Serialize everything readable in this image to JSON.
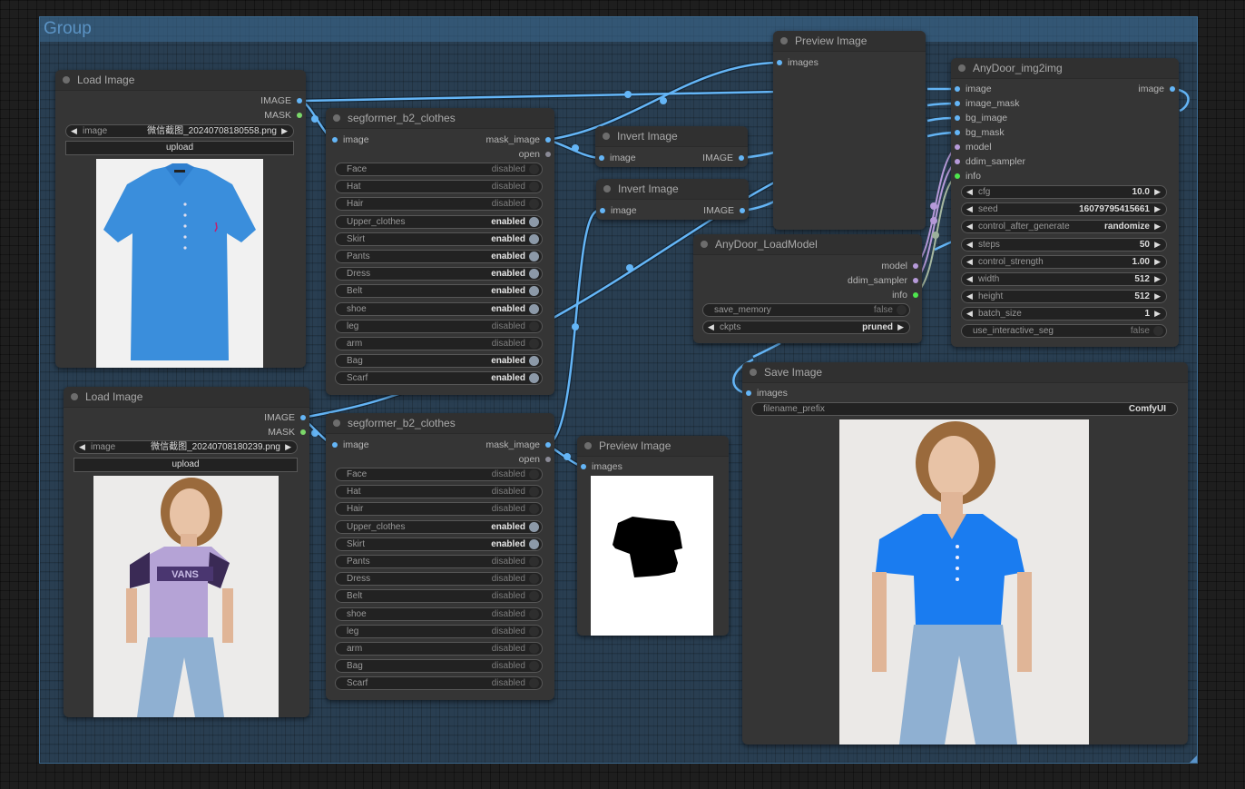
{
  "group": {
    "title": "Group"
  },
  "colors": {
    "image_link": "#64b5f6",
    "mask_slot": "#7bd86a",
    "model_slot": "#b69ad9",
    "info_slot": "#4ee64e",
    "group_bg": "#335a7c"
  },
  "load_image_1": {
    "title": "Load Image",
    "outputs": [
      "IMAGE",
      "MASK"
    ],
    "image_widget": {
      "label": "image",
      "value": "微信截图_20240708180558.png"
    },
    "upload_label": "upload",
    "preview": "blue polo shirt"
  },
  "load_image_2": {
    "title": "Load Image",
    "outputs": [
      "IMAGE",
      "MASK"
    ],
    "image_widget": {
      "label": "image",
      "value": "微信截图_20240708180239.png"
    },
    "upload_label": "upload",
    "preview": "woman in purple VANS t-shirt",
    "shirt_text": "VANS"
  },
  "segformer_1": {
    "title": "segformer_b2_clothes",
    "input": "image",
    "outputs": [
      "mask_image",
      "open"
    ],
    "toggles": [
      {
        "label": "Face",
        "value": "disabled",
        "on": false
      },
      {
        "label": "Hat",
        "value": "disabled",
        "on": false
      },
      {
        "label": "Hair",
        "value": "disabled",
        "on": false
      },
      {
        "label": "Upper_clothes",
        "value": "enabled",
        "on": true
      },
      {
        "label": "Skirt",
        "value": "enabled",
        "on": true
      },
      {
        "label": "Pants",
        "value": "enabled",
        "on": true
      },
      {
        "label": "Dress",
        "value": "enabled",
        "on": true
      },
      {
        "label": "Belt",
        "value": "enabled",
        "on": true
      },
      {
        "label": "shoe",
        "value": "enabled",
        "on": true
      },
      {
        "label": "leg",
        "value": "disabled",
        "on": false
      },
      {
        "label": "arm",
        "value": "disabled",
        "on": false
      },
      {
        "label": "Bag",
        "value": "enabled",
        "on": true
      },
      {
        "label": "Scarf",
        "value": "enabled",
        "on": true
      }
    ]
  },
  "segformer_2": {
    "title": "segformer_b2_clothes",
    "input": "image",
    "outputs": [
      "mask_image",
      "open"
    ],
    "toggles": [
      {
        "label": "Face",
        "value": "disabled",
        "on": false
      },
      {
        "label": "Hat",
        "value": "disabled",
        "on": false
      },
      {
        "label": "Hair",
        "value": "disabled",
        "on": false
      },
      {
        "label": "Upper_clothes",
        "value": "enabled",
        "on": true
      },
      {
        "label": "Skirt",
        "value": "enabled",
        "on": true
      },
      {
        "label": "Pants",
        "value": "disabled",
        "on": false
      },
      {
        "label": "Dress",
        "value": "disabled",
        "on": false
      },
      {
        "label": "Belt",
        "value": "disabled",
        "on": false
      },
      {
        "label": "shoe",
        "value": "disabled",
        "on": false
      },
      {
        "label": "leg",
        "value": "disabled",
        "on": false
      },
      {
        "label": "arm",
        "value": "disabled",
        "on": false
      },
      {
        "label": "Bag",
        "value": "disabled",
        "on": false
      },
      {
        "label": "Scarf",
        "value": "disabled",
        "on": false
      }
    ]
  },
  "invert_1": {
    "title": "Invert Image",
    "input": "image",
    "output": "IMAGE"
  },
  "invert_2": {
    "title": "Invert Image",
    "input": "image",
    "output": "IMAGE"
  },
  "preview_top": {
    "title": "Preview Image",
    "input": "images"
  },
  "preview_mask": {
    "title": "Preview Image",
    "input": "images",
    "preview": "black t-shirt mask on white"
  },
  "load_model": {
    "title": "AnyDoor_LoadModel",
    "outputs": [
      "model",
      "ddim_sampler",
      "info"
    ],
    "save_memory": {
      "label": "save_memory",
      "value": "false"
    },
    "ckpts": {
      "label": "ckpts",
      "value": "pruned"
    }
  },
  "img2img": {
    "title": "AnyDoor_img2img",
    "inputs": [
      "image",
      "image_mask",
      "bg_image",
      "bg_mask",
      "model",
      "ddim_sampler",
      "info"
    ],
    "output": "image",
    "widgets": [
      {
        "label": "cfg",
        "value": "10.0"
      },
      {
        "label": "seed",
        "value": "16079795415661"
      },
      {
        "label": "control_after_generate",
        "value": "randomize"
      },
      {
        "label": "steps",
        "value": "50"
      },
      {
        "label": "control_strength",
        "value": "1.00"
      },
      {
        "label": "width",
        "value": "512"
      },
      {
        "label": "height",
        "value": "512"
      },
      {
        "label": "batch_size",
        "value": "1"
      }
    ],
    "use_interactive_seg": {
      "label": "use_interactive_seg",
      "value": "false"
    }
  },
  "save_image": {
    "title": "Save Image",
    "input": "images",
    "filename_prefix": {
      "label": "filename_prefix",
      "value": "ComfyUI"
    },
    "preview": "woman in blue polo shirt and jeans"
  }
}
